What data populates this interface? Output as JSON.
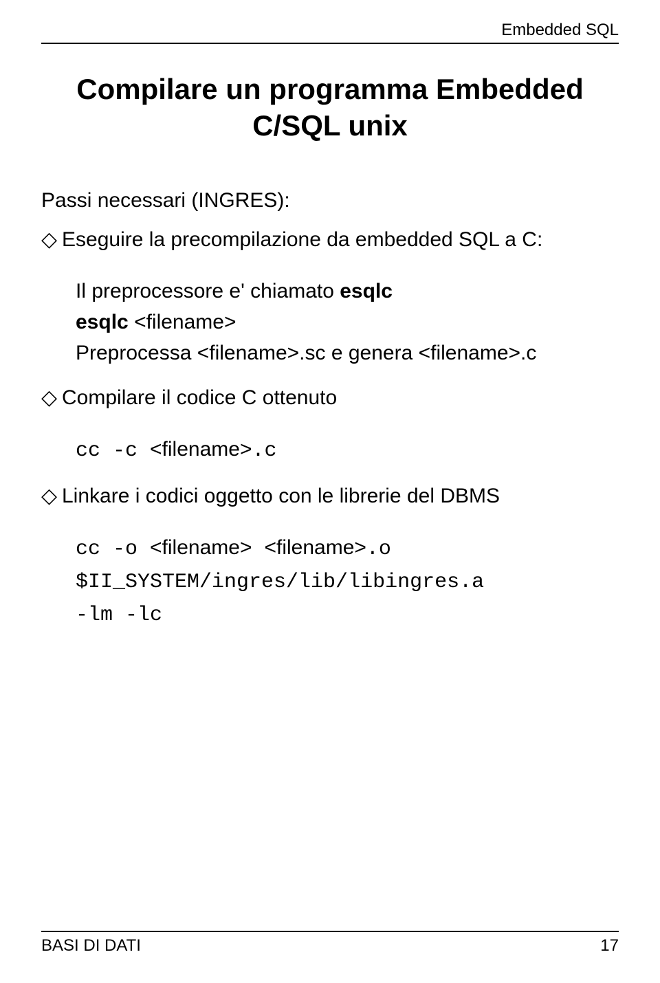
{
  "header": {
    "right": "Embedded SQL"
  },
  "title": {
    "line1": "Compilare un programma Embedded",
    "line2": "C/SQL unix"
  },
  "intro": "Passi necessari (INGRES):",
  "items": {
    "one": {
      "text": "Eseguire la precompilazione da embedded SQL a C:"
    },
    "block1": {
      "line1a": "Il preprocessore e' chiamato ",
      "line1b": "esqlc",
      "line2a": "esqlc ",
      "line2b": "<filename>",
      "line3": "Preprocessa <filename>.sc e genera <filename>.c"
    },
    "two": {
      "text": "Compilare il codice C ottenuto"
    },
    "block2": {
      "code1a": "cc -c ",
      "code1b": "<filename>",
      "code1c": ".c"
    },
    "three": {
      "text": "Linkare i codici oggetto con le librerie del DBMS"
    },
    "block3": {
      "code1a": "cc -o ",
      "code1b": "<filename>",
      "code1c": " ",
      "code1d": "<filename>",
      "code1e": ".o",
      "code2": "$II_SYSTEM/ingres/lib/libingres.a",
      "code3": "-lm -lc"
    }
  },
  "footer": {
    "left": "BASI DI DATI",
    "right": "17"
  }
}
